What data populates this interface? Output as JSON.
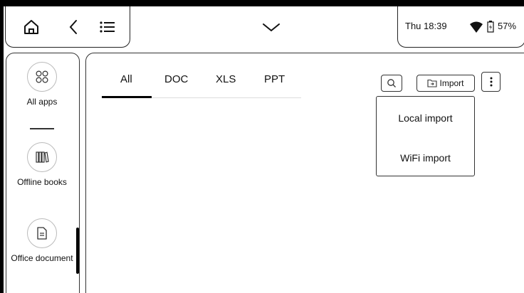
{
  "status": {
    "time": "Thu 18:39",
    "battery": "57%"
  },
  "topbar": {
    "icons": [
      "home-icon",
      "back-icon",
      "list-menu-icon",
      "chevron-down-icon"
    ]
  },
  "sidebar": {
    "items": [
      {
        "label": "All apps",
        "icon": "grid-icon"
      },
      {
        "label": "Offline books",
        "icon": "books-icon"
      },
      {
        "label": "Office document",
        "icon": "document-icon"
      }
    ]
  },
  "tabs": {
    "items": [
      "All",
      "DOC",
      "XLS",
      "PPT"
    ],
    "active": "All"
  },
  "toolbar": {
    "import_label": "Import"
  },
  "import_menu": {
    "items": [
      "Local import",
      "WiFi import"
    ]
  }
}
